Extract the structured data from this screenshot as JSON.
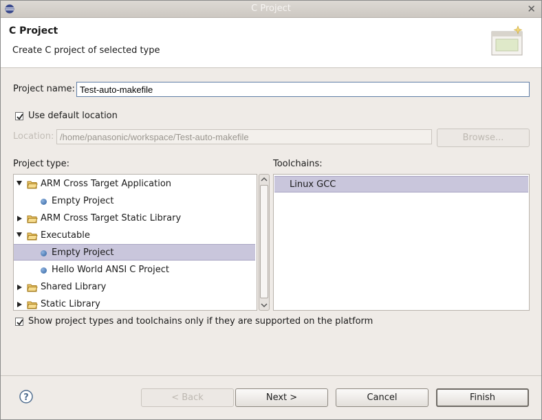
{
  "window": {
    "title": "C Project"
  },
  "header": {
    "title": "C Project",
    "subtitle": "Create C project of selected type"
  },
  "form": {
    "project_name_label": "Project name:",
    "project_name_value": "Test-auto-makefile",
    "use_default_location_label": "Use default location",
    "use_default_location_checked": true,
    "location_label": "Location:",
    "location_value": "/home/panasonic/workspace/Test-auto-makefile",
    "browse_label": "Browse..."
  },
  "project_type": {
    "label": "Project type:",
    "items": [
      {
        "label": "ARM Cross Target Application",
        "kind": "folder",
        "expanded": true
      },
      {
        "label": "Empty Project",
        "kind": "leaf"
      },
      {
        "label": "ARM Cross Target Static Library",
        "kind": "folder",
        "expanded": false
      },
      {
        "label": "Executable",
        "kind": "folder",
        "expanded": true
      },
      {
        "label": "Empty Project",
        "kind": "leaf",
        "selected": true
      },
      {
        "label": "Hello World ANSI C Project",
        "kind": "leaf"
      },
      {
        "label": "Shared Library",
        "kind": "folder",
        "expanded": false
      },
      {
        "label": "Static Library",
        "kind": "folder",
        "expanded": false
      }
    ]
  },
  "toolchains": {
    "label": "Toolchains:",
    "items": [
      {
        "label": "Linux GCC",
        "selected": true
      }
    ]
  },
  "filter": {
    "label": "Show project types and toolchains only if they are supported on the platform",
    "checked": true
  },
  "buttons": {
    "back": "< Back",
    "next": "Next >",
    "cancel": "Cancel",
    "finish": "Finish"
  }
}
